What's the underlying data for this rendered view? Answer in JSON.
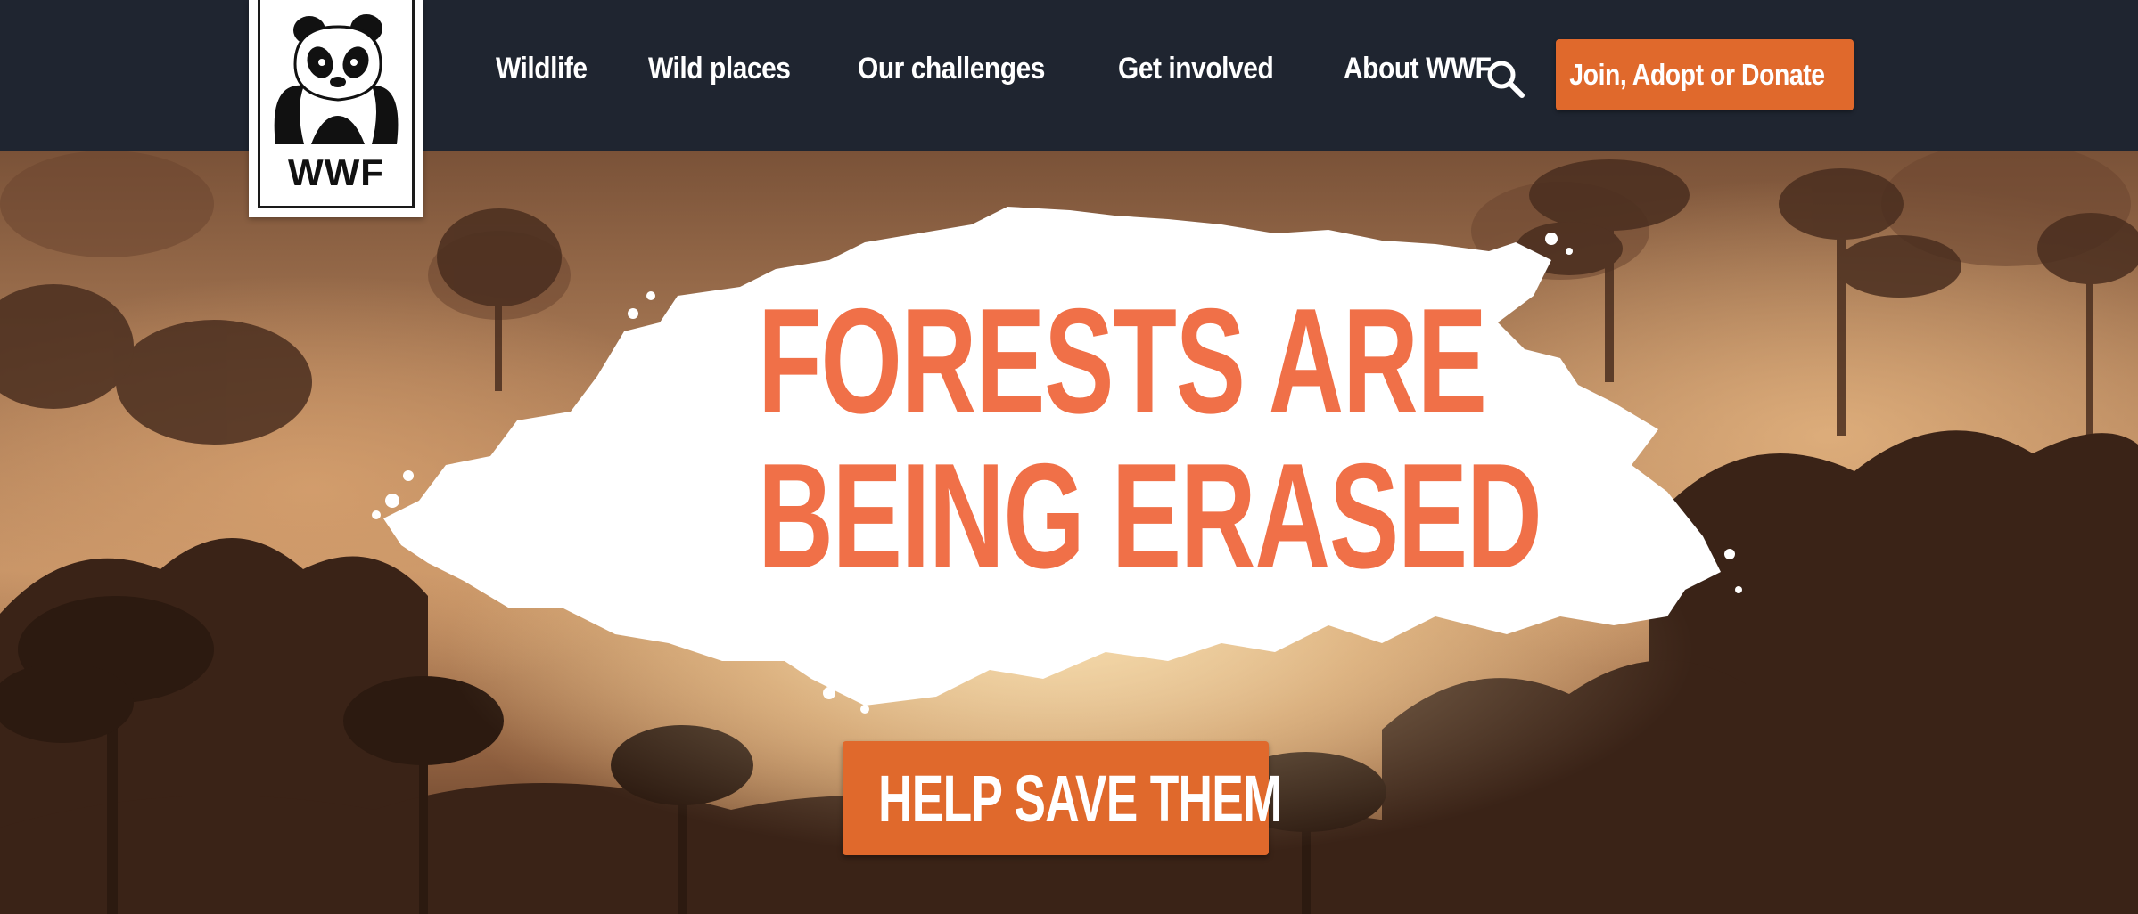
{
  "brand": {
    "logo_text": "WWF"
  },
  "nav": {
    "items": [
      {
        "label": "Wildlife"
      },
      {
        "label": "Wild places"
      },
      {
        "label": "Our challenges"
      },
      {
        "label": "Get involved"
      },
      {
        "label": "About WWF"
      }
    ]
  },
  "header": {
    "search_icon": "search-icon",
    "cta_label": "Join, Adopt or Donate",
    "cta_icon": "chevron-right-icon"
  },
  "hero": {
    "headline_line1": "FORESTS ARE",
    "headline_line2": "BEING ERASED",
    "cta_label": "HELP SAVE THEM",
    "cta_icon": "chevron-right-icon"
  },
  "colors": {
    "nav_background": "#1f2530",
    "accent_orange": "#e0692c",
    "headline_orange": "#f07048",
    "white": "#ffffff"
  }
}
